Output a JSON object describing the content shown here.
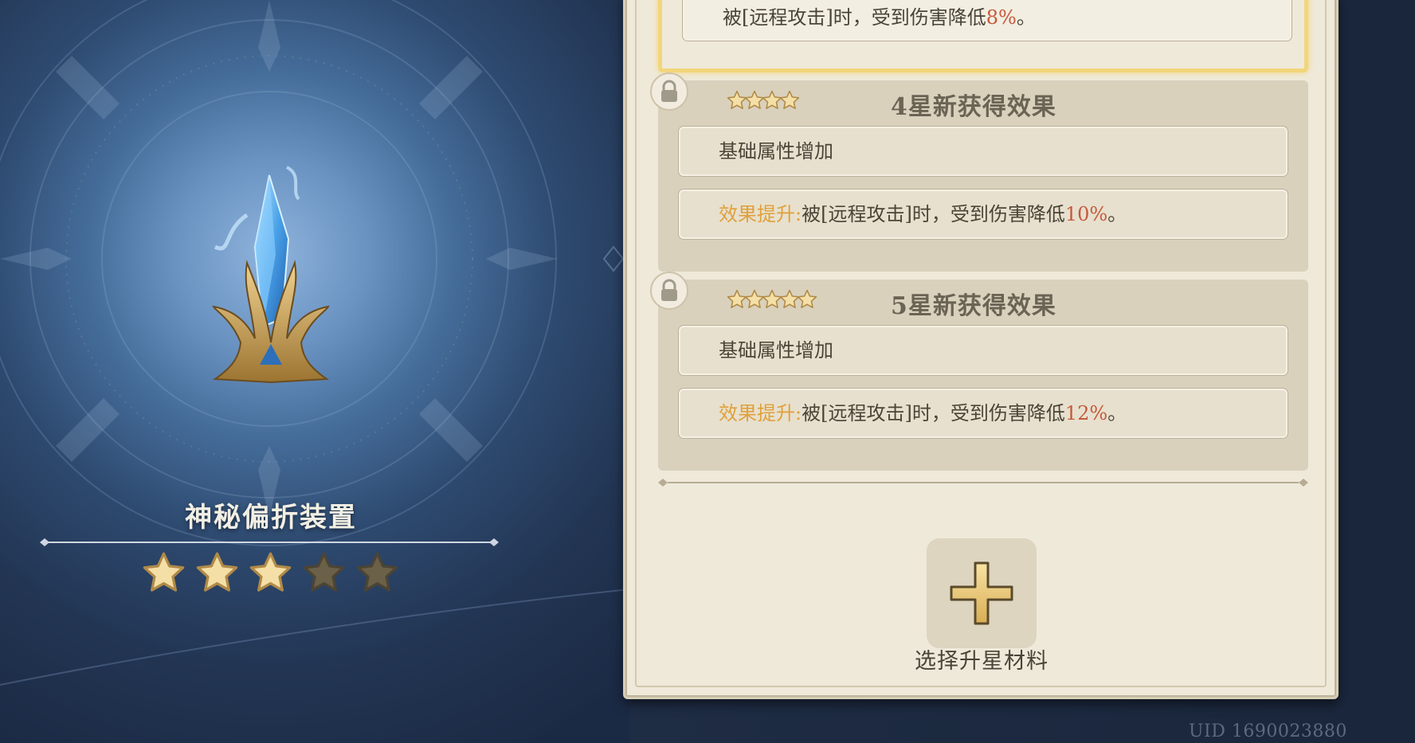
{
  "item": {
    "name": "神秘偏折装置",
    "stars_total": 5,
    "stars_filled": 3
  },
  "tiers": [
    {
      "effects": [
        {
          "prefix": "",
          "text": "被[远程攻击]时，受到伤害降低",
          "value": "8%",
          "suffix": "。"
        }
      ]
    },
    {
      "stars": 4,
      "title": "4星新获得效果",
      "locked": true,
      "effects": [
        {
          "prefix": "",
          "text": "基础属性增加",
          "value": "",
          "suffix": ""
        },
        {
          "prefix": "效果提升:",
          "text": "被[远程攻击]时，受到伤害降低",
          "value": "10%",
          "suffix": "。"
        }
      ]
    },
    {
      "stars": 5,
      "title": "5星新获得效果",
      "locked": true,
      "effects": [
        {
          "prefix": "",
          "text": "基础属性增加",
          "value": "",
          "suffix": ""
        },
        {
          "prefix": "效果提升:",
          "text": "被[远程攻击]时，受到伤害降低",
          "value": "12%",
          "suffix": "。"
        }
      ]
    }
  ],
  "add_material": {
    "label": "选择升星材料"
  },
  "uid": "UID 1690023880",
  "colors": {
    "highlight_orange": "#e0a03a",
    "value_red": "#c55a3c",
    "star_gold": "#f3d57a",
    "panel_bg": "#efe9da"
  }
}
